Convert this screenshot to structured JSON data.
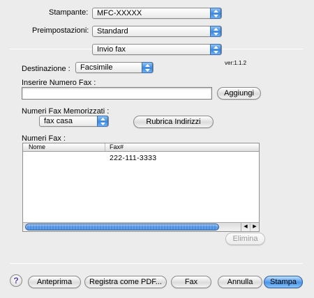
{
  "printer": {
    "label": "Stampante:",
    "value": "MFC-XXXXX"
  },
  "presets": {
    "label": "Preimpostazioni:",
    "value": "Standard"
  },
  "panel": {
    "value": "Invio fax"
  },
  "version": "ver:1.1.2",
  "destination": {
    "label": "Destinazione :",
    "value": "Facsimile"
  },
  "fax_number": {
    "label": "Inserire Numero Fax :",
    "value": "",
    "add_button": "Aggiungi"
  },
  "stored": {
    "label": "Numeri Fax Memorizzati :",
    "value": "fax casa",
    "address_book_button": "Rubrica Indirizzi"
  },
  "fax_list": {
    "label": "Numeri Fax :",
    "columns": [
      "Nome",
      "Fax#"
    ],
    "rows": [
      {
        "name": "",
        "fax": "222-111-3333"
      }
    ],
    "delete_button": "Elimina"
  },
  "footer": {
    "help_icon": "?",
    "preview": "Anteprima",
    "save_pdf": "Registra come PDF...",
    "fax": "Fax",
    "cancel": "Annulla",
    "print": "Stampa"
  },
  "colors": {
    "accent": "#4a95e8",
    "background": "#ececec"
  }
}
